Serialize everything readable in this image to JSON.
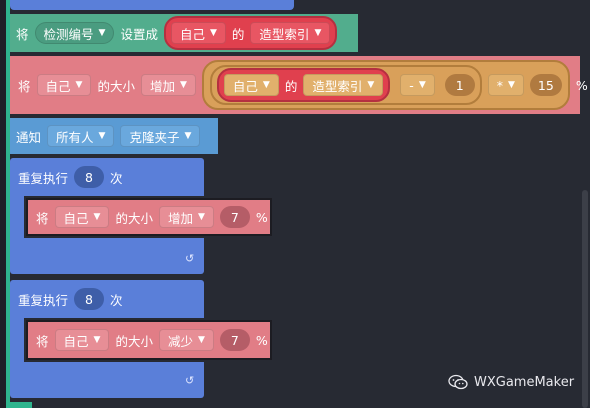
{
  "colors": {
    "canvas_bg": "#272a33",
    "sensing_green": "#52ad8d",
    "looks_red": "#e0404e",
    "looks_pink": "#e17d86",
    "operator_orange": "#d9a05a",
    "event_blue": "#5a9bd4",
    "control_blue": "#5a7fd9"
  },
  "block_set_clone": {
    "jiang": "将",
    "var_dropdown": "检测编号",
    "set_to": "设置成",
    "self": "自己",
    "of": "的",
    "costume_index": "造型索引"
  },
  "block_change_size": {
    "jiang": "将",
    "target": "自己",
    "size_of": "的大小",
    "change": "增加",
    "self": "自己",
    "of": "的",
    "costume_index": "造型索引",
    "minus": "-",
    "n1": "1",
    "times": "*",
    "n15": "15",
    "percent": "%"
  },
  "block_broadcast": {
    "notify": "通知",
    "target": "所有人",
    "clone_folder": "克隆夹子"
  },
  "loop_1": {
    "repeat": "重复执行",
    "count": "8",
    "times": "次",
    "inner": {
      "jiang": "将",
      "target": "自己",
      "size_of": "的大小",
      "op": "增加",
      "value": "7",
      "percent": "%"
    }
  },
  "loop_2": {
    "repeat": "重复执行",
    "count": "8",
    "times": "次",
    "inner": {
      "jiang": "将",
      "target": "自己",
      "size_of": "的大小",
      "op": "减少",
      "value": "7",
      "percent": "%"
    }
  },
  "icons": {
    "caret": "caret-down-icon",
    "loop": "loop-arrow-icon",
    "wechat": "wechat-icon"
  },
  "watermark": {
    "text": "WXGameMaker"
  }
}
